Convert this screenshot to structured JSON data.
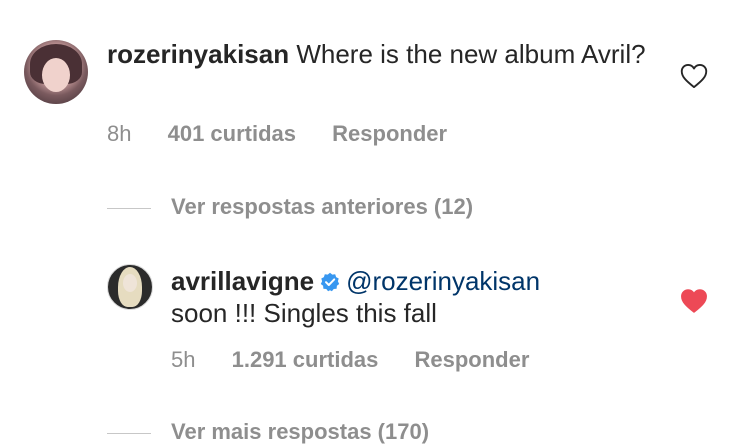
{
  "comments": [
    {
      "username": "rozerinyakisan",
      "text": "Where is the new album Avril?",
      "time": "8h",
      "likes": "401 curtidas",
      "reply": "Responder",
      "liked": false,
      "avatar_icon": "profile-photo"
    },
    {
      "username": "avrillavigne",
      "verified": true,
      "mention": "@rozerinyakisan",
      "text": "soon !!! Singles this fall",
      "time": "5h",
      "likes": "1.291 curtidas",
      "reply": "Responder",
      "liked": true,
      "avatar_icon": "profile-photo"
    }
  ],
  "thread": {
    "previous_replies": "Ver respostas anteriores (12)",
    "more_replies": "Ver mais respostas (170)"
  },
  "colors": {
    "text": "#262626",
    "muted": "#8e8e8e",
    "mention": "#003569",
    "liked_heart": "#ed4956",
    "verified": "#3897f0"
  }
}
